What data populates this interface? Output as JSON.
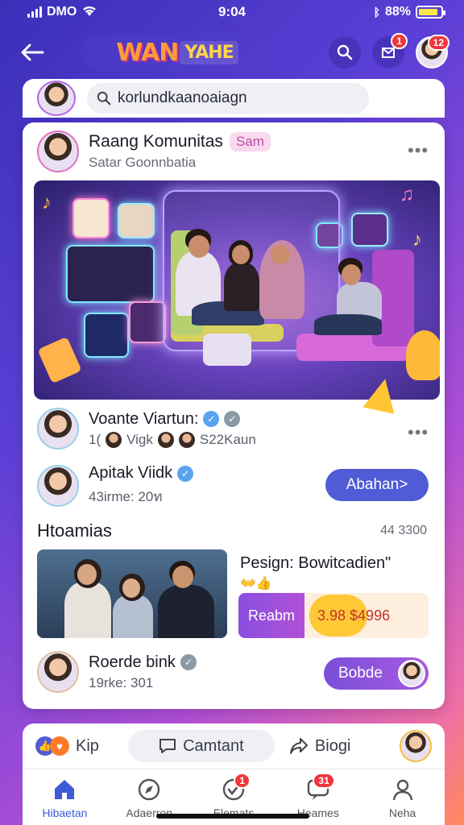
{
  "status_bar": {
    "carrier": "DMO",
    "time": "9:04",
    "battery": "88%",
    "battery_level": 0.88
  },
  "header": {
    "logo_part1": "WAN",
    "logo_part2": "YAHE",
    "notification_count": "1",
    "profile_count": "12"
  },
  "search": {
    "placeholder": "korlundkaanoaiagn"
  },
  "post": {
    "title": "Raang Komunitas",
    "tag": "Sam",
    "subtitle": "Satar Goonnbatia",
    "more": "•••"
  },
  "rows": [
    {
      "title": "Voante Viartun:",
      "sub_prefix": "1(",
      "sub_a": "Vigk",
      "sub_b": "S22Kaun",
      "more": "•••"
    },
    {
      "title": "Apitak Viidk",
      "sub": "43irme: 20ท",
      "button": "Abahan>"
    }
  ],
  "section": {
    "title": "Htoamias",
    "count": "44  3300"
  },
  "promo": {
    "title": "Pesign: Bowitcadien\"",
    "emojis": "👐👍",
    "button": "Reabm",
    "price": "3.98 $4996"
  },
  "row3": {
    "title": "Roerde bink",
    "sub": "19rke: 301",
    "button": "Bobde"
  },
  "actions": {
    "like": "Kip",
    "comment": "Camtant",
    "share": "Biogi"
  },
  "nav": [
    {
      "label": "Hibaetan",
      "badge": ""
    },
    {
      "label": "Adaerron",
      "badge": ""
    },
    {
      "label": "Elemats",
      "badge": "1"
    },
    {
      "label": "Heames",
      "badge": "31"
    },
    {
      "label": "Neha",
      "badge": ""
    }
  ]
}
